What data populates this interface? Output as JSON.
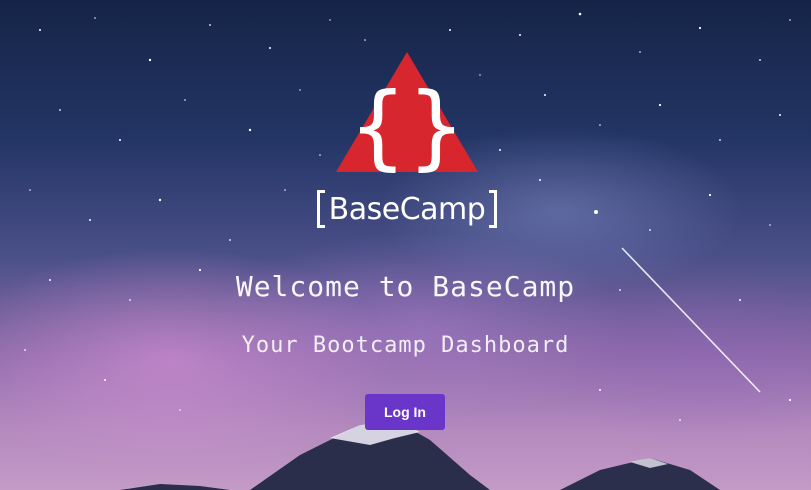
{
  "brand": {
    "name": "BaseCamp",
    "logo_glyph": "{}",
    "logo_color": "#d8262f"
  },
  "hero": {
    "title": "Welcome to BaseCamp",
    "subtitle": "Your Bootcamp Dashboard"
  },
  "actions": {
    "login_label": "Log In",
    "login_color": "#6a35c9"
  },
  "background": {
    "description_icon": "starry-sky-background"
  }
}
